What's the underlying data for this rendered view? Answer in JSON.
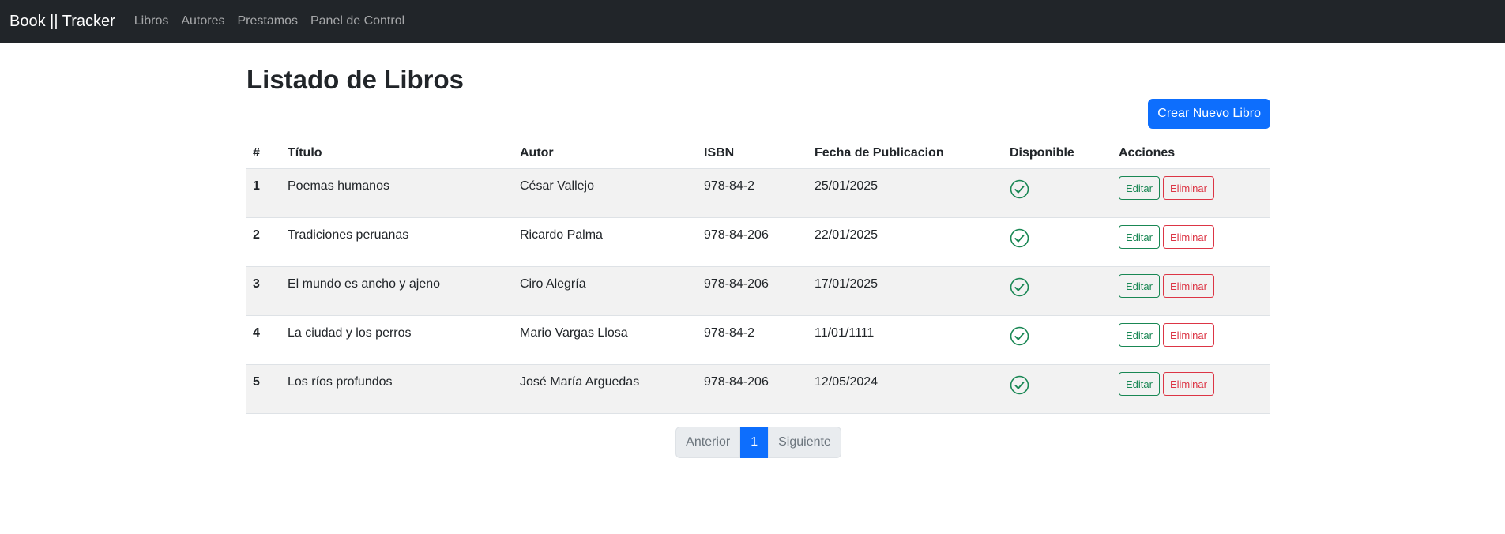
{
  "navbar": {
    "brand": "Book || Tracker",
    "links": [
      "Libros",
      "Autores",
      "Prestamos",
      "Panel de Control"
    ]
  },
  "page": {
    "title": "Listado de Libros",
    "create_button": "Crear Nuevo Libro"
  },
  "table": {
    "headers": [
      "#",
      "Título",
      "Autor",
      "ISBN",
      "Fecha de Publicacion",
      "Disponible",
      "Acciones"
    ],
    "rows": [
      {
        "num": "1",
        "title": "Poemas humanos",
        "author": "César Vallejo",
        "isbn": "978-84-2",
        "date": "25/01/2025",
        "available": true
      },
      {
        "num": "2",
        "title": "Tradiciones peruanas",
        "author": "Ricardo Palma",
        "isbn": "978-84-206",
        "date": "22/01/2025",
        "available": true
      },
      {
        "num": "3",
        "title": "El mundo es ancho y ajeno",
        "author": "Ciro Alegría",
        "isbn": "978-84-206",
        "date": "17/01/2025",
        "available": true
      },
      {
        "num": "4",
        "title": "La ciudad y los perros",
        "author": "Mario Vargas Llosa",
        "isbn": "978-84-2",
        "date": "11/01/1111",
        "available": true
      },
      {
        "num": "5",
        "title": "Los ríos profundos",
        "author": "José María Arguedas",
        "isbn": "978-84-206",
        "date": "12/05/2024",
        "available": true
      }
    ],
    "edit_label": "Editar",
    "delete_label": "Eliminar",
    "available_icon": "check-circle-icon"
  },
  "pagination": {
    "prev": "Anterior",
    "current": "1",
    "next": "Siguiente"
  },
  "colors": {
    "navbar": "#212529",
    "primary": "#0d6efd",
    "success": "#198754",
    "danger": "#dc3545"
  }
}
